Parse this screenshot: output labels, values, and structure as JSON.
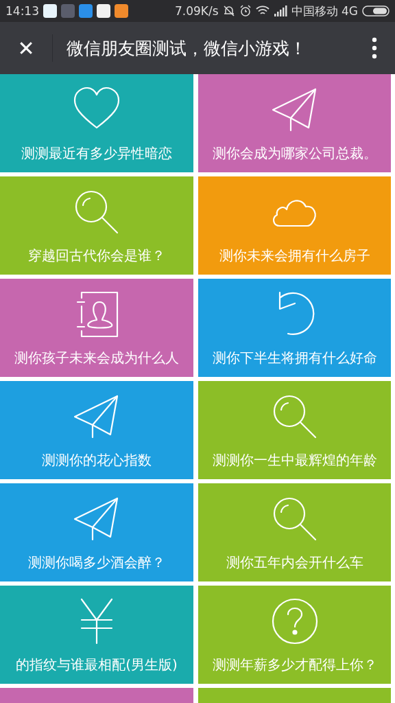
{
  "status_bar": {
    "time": "14:13",
    "speed": "7.09K/s",
    "carrier": "中国移动 4G"
  },
  "header": {
    "close": "✕",
    "title": "微信朋友圈测试，微信小游戏！"
  },
  "tiles": [
    {
      "label": "测测最近有多少异性暗恋",
      "kind": "heart",
      "color": "#1aabac"
    },
    {
      "label": "测你会成为哪家公司总裁。",
      "kind": "plane",
      "color": "#c667ae"
    },
    {
      "label": "穿越回古代你会是谁？",
      "kind": "search",
      "color": "#8cbe27"
    },
    {
      "label": "测你未来会拥有什么房子",
      "kind": "cloud",
      "color": "#f29b0e"
    },
    {
      "label": "测你孩子未来会成为什么人",
      "kind": "contact",
      "color": "#c667ae"
    },
    {
      "label": "测你下半生将拥有什么好命",
      "kind": "undo",
      "color": "#1e9fe0"
    },
    {
      "label": "测测你的花心指数",
      "kind": "plane",
      "color": "#1e9fe0"
    },
    {
      "label": "测测你一生中最辉煌的年龄",
      "kind": "search",
      "color": "#8cbe27"
    },
    {
      "label": "测测你喝多少酒会醉？",
      "kind": "plane",
      "color": "#1e9fe0"
    },
    {
      "label": "测你五年内会开什么车",
      "kind": "search",
      "color": "#8cbe27"
    },
    {
      "label": "的指纹与谁最相配(男生版)",
      "kind": "yen",
      "color": "#1aabac"
    },
    {
      "label": "测测年薪多少才配得上你？",
      "kind": "question",
      "color": "#8cbe27"
    },
    {
      "kind": "blank",
      "color": "#c667ae"
    },
    {
      "kind": "blank",
      "color": "#8cbe27"
    }
  ]
}
